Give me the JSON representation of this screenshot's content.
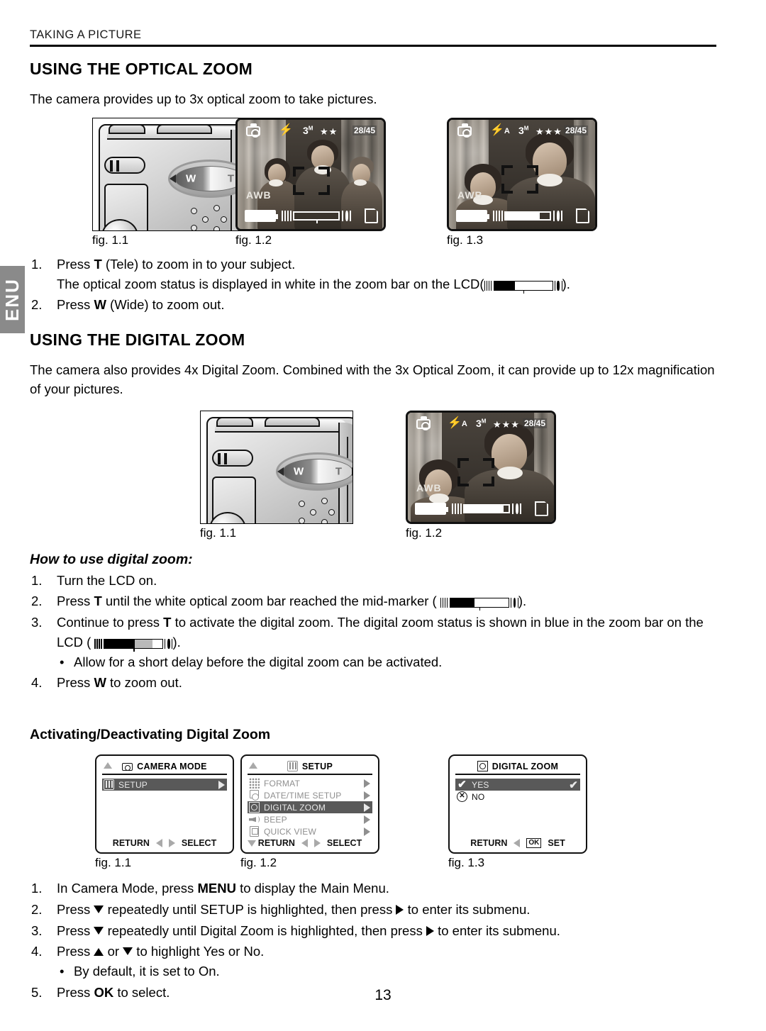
{
  "language_tab": "ENU",
  "running_head": "TAKING A PICTURE",
  "page_number": "13",
  "sections": {
    "optical": {
      "heading": "USING THE OPTICAL ZOOM",
      "intro": "The camera provides up to 3x optical zoom to take pictures.",
      "figures": [
        {
          "caption": "fig. 1.1"
        },
        {
          "caption": "fig. 1.2"
        },
        {
          "caption": "fig. 1.3"
        }
      ],
      "steps": [
        {
          "num": "1.",
          "text_before": "Press ",
          "key": "T",
          "text_after": " (Tele) to zoom in to your subject."
        },
        {
          "num": "2.",
          "text_before": "Press ",
          "key": "W",
          "text_after": " (Wide) to zoom out."
        }
      ],
      "step1_note_before": "The optical zoom status is displayed in white in the zoom bar on the LCD(",
      "step1_note_after": ")."
    },
    "digital": {
      "heading": "USING THE DIGITAL ZOOM",
      "intro": "The camera also provides 4x Digital Zoom. Combined with the 3x Optical Zoom, it can provide up to 12x magnification of your pictures.",
      "figures": [
        {
          "caption": "fig. 1.1"
        },
        {
          "caption": "fig. 1.2"
        }
      ],
      "howto_heading": "How to use digital zoom:",
      "steps": [
        {
          "num": "1.",
          "text": "Turn the LCD on."
        },
        {
          "num": "2.",
          "text_before": "Press ",
          "key": "T",
          "text_mid": " until the white optical zoom bar reached the mid-marker ( ",
          "text_after": ")."
        },
        {
          "num": "3.",
          "text_before": "Continue to press ",
          "key": "T",
          "text_mid": " to activate the digital zoom. The digital zoom status is shown in blue in the zoom bar on the LCD ( ",
          "text_after": ")."
        },
        {
          "num": "4.",
          "text_before": "Press ",
          "key": "W",
          "text_after": " to zoom out."
        }
      ],
      "bullet": "Allow for a short delay before the digital zoom can be activated."
    },
    "activating": {
      "heading": "Activating/Deactivating Digital Zoom",
      "figures": [
        {
          "caption": "fig. 1.1"
        },
        {
          "caption": "fig. 1.2"
        },
        {
          "caption": "fig. 1.3"
        }
      ],
      "steps": [
        {
          "num": "1.",
          "text_before": "In Camera Mode, press ",
          "key": "MENU",
          "text_after": " to display the Main Menu."
        },
        {
          "num": "2.",
          "text_before": "Press ",
          "glyph": "down-arrow",
          "text_mid": " repeatedly until SETUP is highlighted, then press ",
          "glyph2": "right-arrow",
          "text_after": " to enter its submenu."
        },
        {
          "num": "3.",
          "text_before": "Press ",
          "glyph": "down-arrow",
          "text_mid": " repeatedly until Digital Zoom is highlighted, then press ",
          "glyph2": "right-arrow",
          "text_after": " to enter its submenu."
        },
        {
          "num": "4.",
          "text_before": "Press ",
          "glyph": "up-arrow",
          "text_mid": " or ",
          "glyph2": "down-arrow",
          "text_after": " to highlight Yes or No."
        },
        {
          "num": "5.",
          "text_before": "Press ",
          "key": "OK",
          "text_after": " to select."
        }
      ],
      "bullet": "By default, it is set to On."
    }
  },
  "lcd_osd": {
    "fig12": {
      "flash": "⚡",
      "resolution": "3",
      "resolution_sup": "M",
      "stars": "★★",
      "counter": "28/45",
      "white_balance": "AWB",
      "zoom_fill_percent": 0
    },
    "fig13": {
      "flash": "⚡",
      "flash_mode": "A",
      "resolution": "3",
      "resolution_sup": "M",
      "stars": "★★★",
      "counter": "28/45",
      "white_balance": "AWB",
      "zoom_fill_percent": 78
    },
    "digital_fig12": {
      "flash": "⚡",
      "flash_mode": "A",
      "resolution": "3",
      "resolution_sup": "M",
      "stars": "★★★",
      "counter": "28/45",
      "white_balance": "AWB",
      "zoom_fill_percent": 88
    }
  },
  "camera_controls": {
    "wide_label": "W",
    "tele_label": "T"
  },
  "menus": {
    "camera_mode": {
      "title": "CAMERA MODE",
      "items": [
        {
          "label": "SETUP",
          "selected": true
        }
      ],
      "footer_left": "RETURN",
      "footer_right": "SELECT"
    },
    "setup": {
      "title": "SETUP",
      "items": [
        {
          "label": "FORMAT",
          "selected": false
        },
        {
          "label": "DATE/TIME SETUP",
          "selected": false
        },
        {
          "label": "DIGITAL ZOOM",
          "selected": true
        },
        {
          "label": "BEEP",
          "selected": false
        },
        {
          "label": "QUICK VIEW",
          "selected": false
        }
      ],
      "footer_left": "RETURN",
      "footer_right": "SELECT"
    },
    "digital_zoom": {
      "title": "DIGITAL  ZOOM",
      "items": [
        {
          "label": "YES",
          "selected": true
        },
        {
          "label": "NO",
          "selected": false
        }
      ],
      "footer_left": "RETURN",
      "footer_ok": "OK",
      "footer_right": "SET"
    }
  },
  "colors": {
    "tab_gray": "#8a8a8a",
    "menu_highlight": "#595959",
    "menu_text": "#8f8f8f",
    "rule_black": "#000000"
  }
}
